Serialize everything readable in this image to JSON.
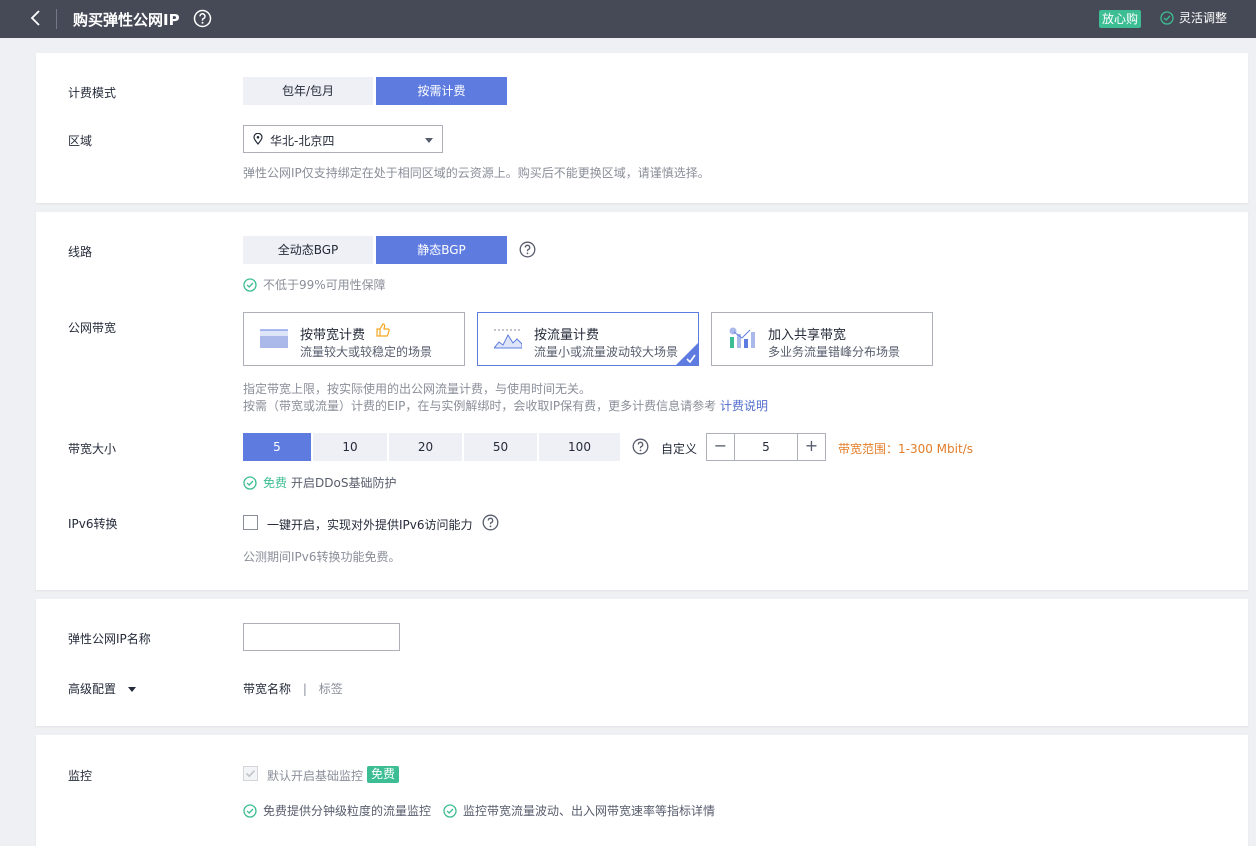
{
  "header": {
    "title": "购买弹性公网IP",
    "badge": "放心购",
    "flex_adjust": "灵活调整"
  },
  "billing": {
    "label": "计费模式",
    "options": [
      "包年/包月",
      "按需计费"
    ],
    "selected": "按需计费"
  },
  "region": {
    "label": "区域",
    "value": "华北-北京四",
    "hint": "弹性公网IP仅支持绑定在处于相同区域的云资源上。购买后不能更换区域，请谨慎选择。"
  },
  "line": {
    "label": "线路",
    "options": [
      "全动态BGP",
      "静态BGP"
    ],
    "selected": "静态BGP",
    "note": "不低于99%可用性保障"
  },
  "bandwidth_type": {
    "label": "公网带宽",
    "cards": [
      {
        "title": "按带宽计费",
        "sub": "流量较大或较稳定的场景"
      },
      {
        "title": "按流量计费",
        "sub": "流量小或流量波动较大场景"
      },
      {
        "title": "加入共享带宽",
        "sub": "多业务流量错峰分布场景"
      }
    ],
    "selected": "按流量计费",
    "hint1": "指定带宽上限，按实际使用的出公网流量计费，与使用时间无关。",
    "hint2": "按需（带宽或流量）计费的EIP，在与实例解绑时，会收取IP保有费，更多计费信息请参考",
    "link": "计费说明"
  },
  "bandwidth_size": {
    "label": "带宽大小",
    "options": [
      "5",
      "10",
      "20",
      "50",
      "100"
    ],
    "selected": "5",
    "custom_label": "自定义",
    "value": "5",
    "range": "带宽范围：1-300 Mbit/s",
    "free_word": "免费",
    "ddos_note": "开启DDoS基础防护"
  },
  "ipv6": {
    "label": "IPv6转换",
    "checkbox_label": "一键开启，实现对外提供IPv6访问能力",
    "checked": false,
    "hint": "公测期间IPv6转换功能免费。"
  },
  "eip_name": {
    "label": "弹性公网IP名称",
    "value": ""
  },
  "advanced": {
    "label": "高级配置",
    "items": [
      "带宽名称",
      "标签"
    ],
    "separator": "|"
  },
  "monitor": {
    "label": "监控",
    "checkbox_label": "默认开启基础监控",
    "checked": true,
    "free_tag": "免费",
    "note1": "免费提供分钟级粒度的流量监控",
    "note2": "监控带宽流量波动、出入网带宽速率等指标详情"
  },
  "colors": {
    "accent": "#5e7ce0",
    "success": "#3dbd93",
    "warning": "#e37d29",
    "header_bg": "#454a56"
  }
}
